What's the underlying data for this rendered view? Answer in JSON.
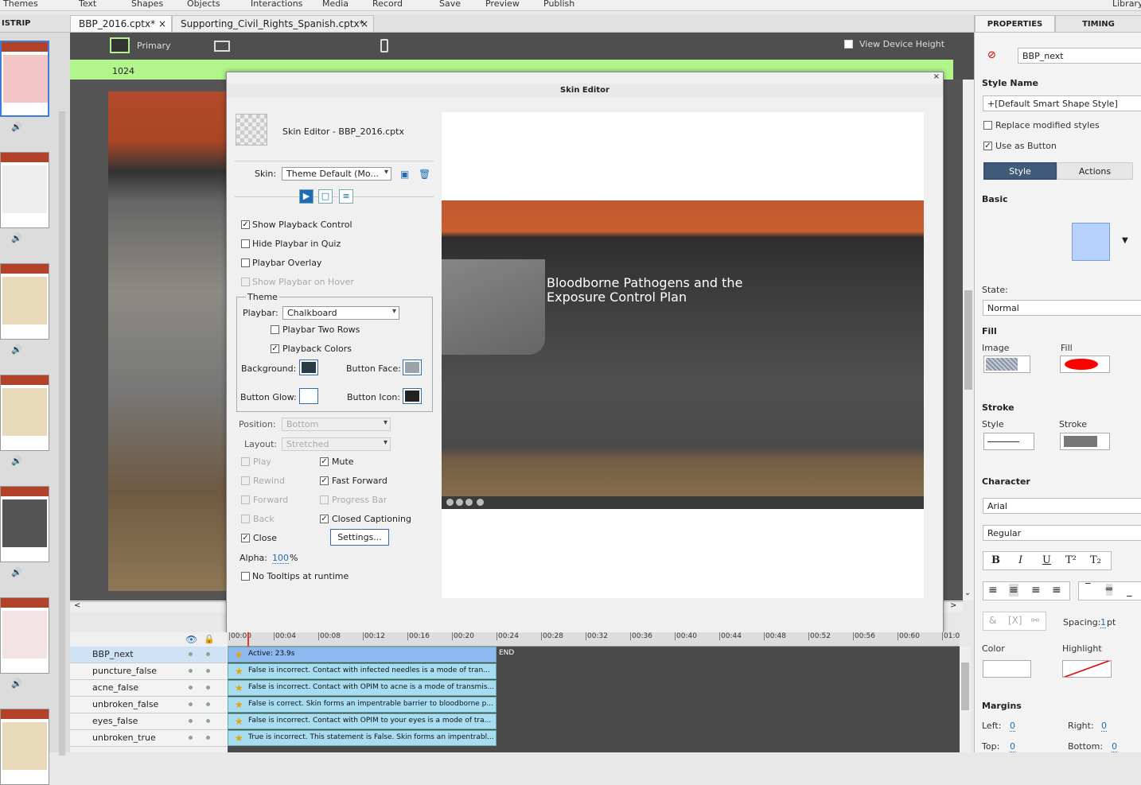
{
  "menu": [
    "Themes",
    "Text",
    "Shapes",
    "Objects",
    "Interactions",
    "Media",
    "Record",
    "Save",
    "Preview",
    "Publish",
    "Library"
  ],
  "filmstrip_header": "ISTRIP",
  "tabs": [
    {
      "label": "BBP_2016.cptx*"
    },
    {
      "label": "Supporting_Civil_Rights_Spanish.cptx*"
    }
  ],
  "view": {
    "primary": "Primary",
    "ruler_value": "1024",
    "device_height": "View Device Height"
  },
  "skin_editor": {
    "title": "Skin Editor",
    "subtitle": "Skin Editor - BBP_2016.cptx",
    "skin_label": "Skin:",
    "skin_value": "Theme Default (Mo...",
    "show_playback": "Show Playback Control",
    "hide_playbar_quiz": "Hide Playbar in Quiz",
    "playbar_overlay": "Playbar Overlay",
    "show_on_hover": "Show Playbar on Hover",
    "theme_legend": "Theme",
    "playbar_label": "Playbar:",
    "playbar_value": "Chalkboard",
    "two_rows": "Playbar Two Rows",
    "playback_colors": "Playback Colors",
    "background": "Background:",
    "button_face": "Button Face:",
    "button_glow": "Button Glow:",
    "button_icon": "Button Icon:",
    "position_label": "Position:",
    "position_value": "Bottom",
    "layout_label": "Layout:",
    "layout_value": "Stretched",
    "play": "Play",
    "rewind": "Rewind",
    "forward": "Forward",
    "back": "Back",
    "close": "Close",
    "mute": "Mute",
    "fast_forward": "Fast Forward",
    "progress_bar": "Progress Bar",
    "closed_captioning": "Closed Captioning",
    "settings": "Settings...",
    "alpha_label": "Alpha:",
    "alpha_value": "100",
    "alpha_unit": "%",
    "no_tooltips": "No Tooltips at runtime",
    "preview_title_1": "Bloodborne Pathogens and the",
    "preview_title_2": "Exposure Control Plan"
  },
  "properties": {
    "tab_properties": "PROPERTIES",
    "tab_timing": "TIMING",
    "name_value": "BBP_next",
    "style_name_label": "Style Name",
    "style_name_value": "+[Default Smart Shape Style]",
    "replace_modified": "Replace modified styles",
    "use_as_button": "Use as Button",
    "tab_style": "Style",
    "tab_actions": "Actions",
    "basic": "Basic",
    "state_label": "State:",
    "state_value": "Normal",
    "fill_section": "Fill",
    "image_label": "Image",
    "fill_label": "Fill",
    "stroke_section": "Stroke",
    "style_label": "Style",
    "stroke_label": "Stroke",
    "character": "Character",
    "font_value": "Arial",
    "weight_value": "Regular",
    "spacing_label": "Spacing:",
    "spacing_value": "1",
    "spacing_unit": "pt",
    "color_label": "Color",
    "highlight_label": "Highlight",
    "margins": "Margins",
    "left_label": "Left:",
    "left_value": "0",
    "right_label": "Right:",
    "right_value": "0",
    "top_label": "Top:",
    "top_value": "0",
    "bottom_label": "Bottom:",
    "bottom_value": "0",
    "colors": {
      "fill": "#ff0000",
      "basic_swatch": "#b6d1fb",
      "accent": "#1e6bb8"
    }
  },
  "timeline": {
    "ticks": [
      "00:00",
      "00:04",
      "00:08",
      "00:12",
      "00:16",
      "00:20",
      "00:24",
      "00:28",
      "00:32",
      "00:36",
      "00:40",
      "00:44",
      "00:48",
      "00:52",
      "00:56",
      "00:60",
      "01:0"
    ],
    "end": "END",
    "rows": [
      {
        "name": "BBP_next",
        "bar": "Active: 23.9s"
      },
      {
        "name": "puncture_false",
        "bar": "False is incorrect.  Contact with infected needles is a mode of tran..."
      },
      {
        "name": "acne_false",
        "bar": "False is incorrect.  Contact with OPIM to acne is a mode of transmis..."
      },
      {
        "name": "unbroken_false",
        "bar": "False is correct.  Skin forms an impentrable barrier to bloodborne p..."
      },
      {
        "name": "eyes_false",
        "bar": "False is incorrect.  Contact with OPIM to your eyes is a mode of tra..."
      },
      {
        "name": "unbroken_true",
        "bar": "True is incorrect.  This statement is False. Skin forms an impentrabl..."
      }
    ]
  }
}
